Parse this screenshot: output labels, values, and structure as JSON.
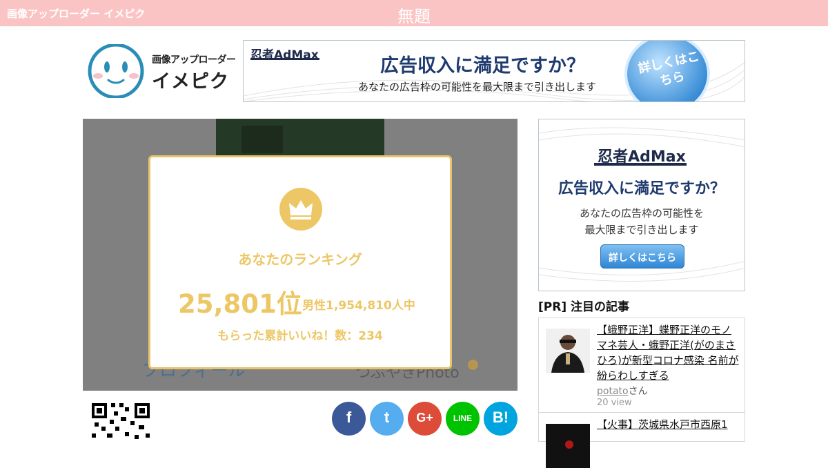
{
  "header": {
    "site_name": "画像アップローダー イメピク",
    "page_title": "無題"
  },
  "logo": {
    "line1": "画像アップローダー",
    "line2": "イメピク"
  },
  "ad_top": {
    "brand": "忍者AdMax",
    "headline": "広告収入に満足ですか？",
    "subline": "あなたの広告枠の可能性を最大限まで引き出します",
    "button": "詳しくはこちら"
  },
  "image_overlay": {
    "ghost_text_left": "プロフィール",
    "ghost_text_right": "つぶやきPhoto"
  },
  "ranking": {
    "label": "あなたのランキング",
    "position": "25,801位",
    "total": "/ 男性1,954,810人中",
    "likes": "もらった累計いいね！数：234"
  },
  "share": {
    "facebook": "f",
    "twitter": "t",
    "googleplus": "G+",
    "line": "LINE",
    "hatena": "B!"
  },
  "ad_side": {
    "brand": "忍者AdMax",
    "headline": "広告収入に満足ですか？",
    "sub1": "あなたの広告枠の可能性を",
    "sub2": "最大限まで引き出します",
    "button": "詳しくはこちら"
  },
  "pr": {
    "heading": "[PR] 注目の記事",
    "items": [
      {
        "title": "【蛾野正洋】蝶野正洋のモノマネ芸人・蛾野正洋(がのまさひろ)が新型コロナ感染 名前が紛らわしすぎる",
        "author": "potato",
        "author_suffix": "さん",
        "views": "20 view"
      },
      {
        "title": "【火事】茨城県水戸市西原1"
      }
    ]
  }
}
